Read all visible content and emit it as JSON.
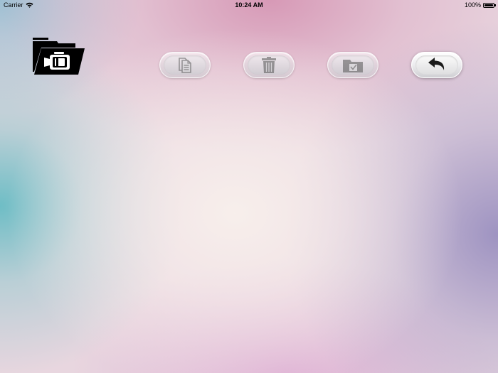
{
  "status_bar": {
    "carrier": "Carrier",
    "wifi_icon": "wifi-icon",
    "time": "10:24 AM",
    "battery_percent": "100%",
    "battery_level": 1.0,
    "battery_icon": "battery-icon"
  },
  "app": {
    "logo_icon": "video-folder-icon"
  },
  "toolbar": {
    "buttons": [
      {
        "name": "copy",
        "icon": "copy-documents-icon",
        "enabled": false
      },
      {
        "name": "delete",
        "icon": "trash-icon",
        "enabled": false
      },
      {
        "name": "move-to-folder",
        "icon": "folder-check-icon",
        "enabled": false
      },
      {
        "name": "back",
        "icon": "back-arrow-icon",
        "enabled": true
      }
    ]
  }
}
